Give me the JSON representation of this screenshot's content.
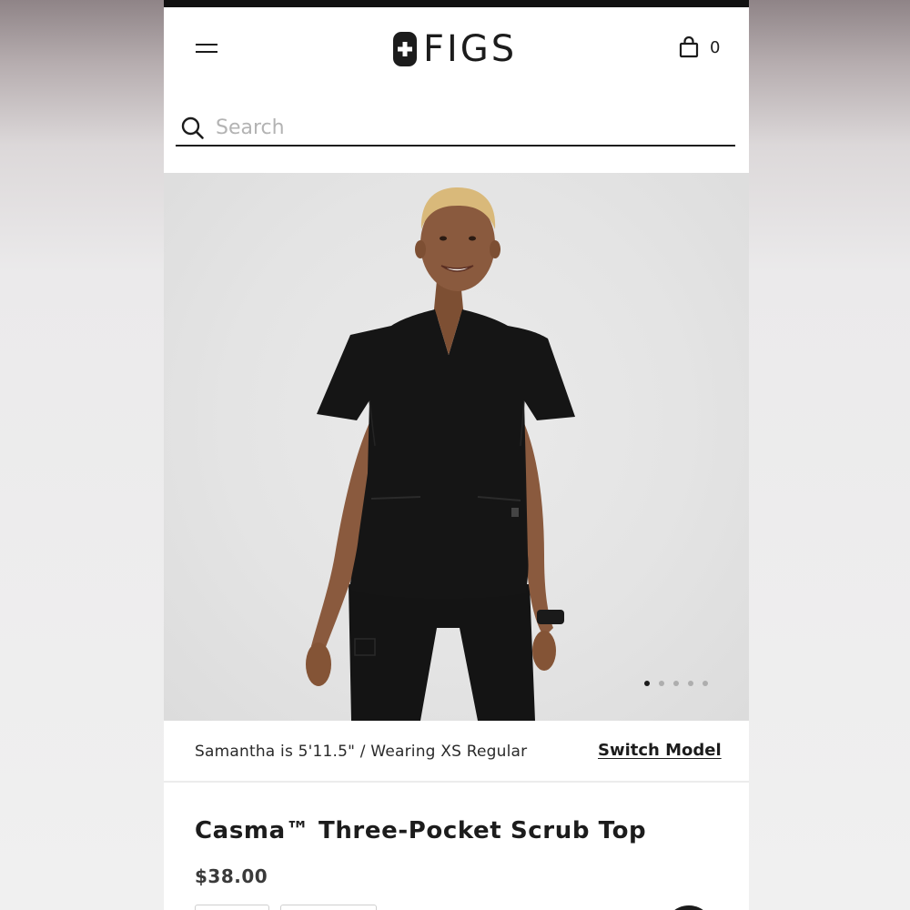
{
  "header": {
    "brand": "FIGS",
    "cart_count": "0"
  },
  "search": {
    "placeholder": "Search",
    "value": ""
  },
  "gallery": {
    "image_count": 5,
    "active_index": 0
  },
  "model_info": {
    "text": "Samantha is 5'11.5\" / Wearing XS Regular",
    "switch_label": "Switch Model"
  },
  "product": {
    "title": "Casma™ Three-Pocket Scrub Top",
    "price": "$38.00"
  },
  "colors": {
    "text_primary": "#1c1c1c",
    "placeholder": "#b3b3b3",
    "scrub_black": "#151515"
  },
  "icons": {
    "menu": "menu-icon",
    "logo": "figs-cross-logo",
    "cart": "bag-icon",
    "search": "search-icon"
  }
}
